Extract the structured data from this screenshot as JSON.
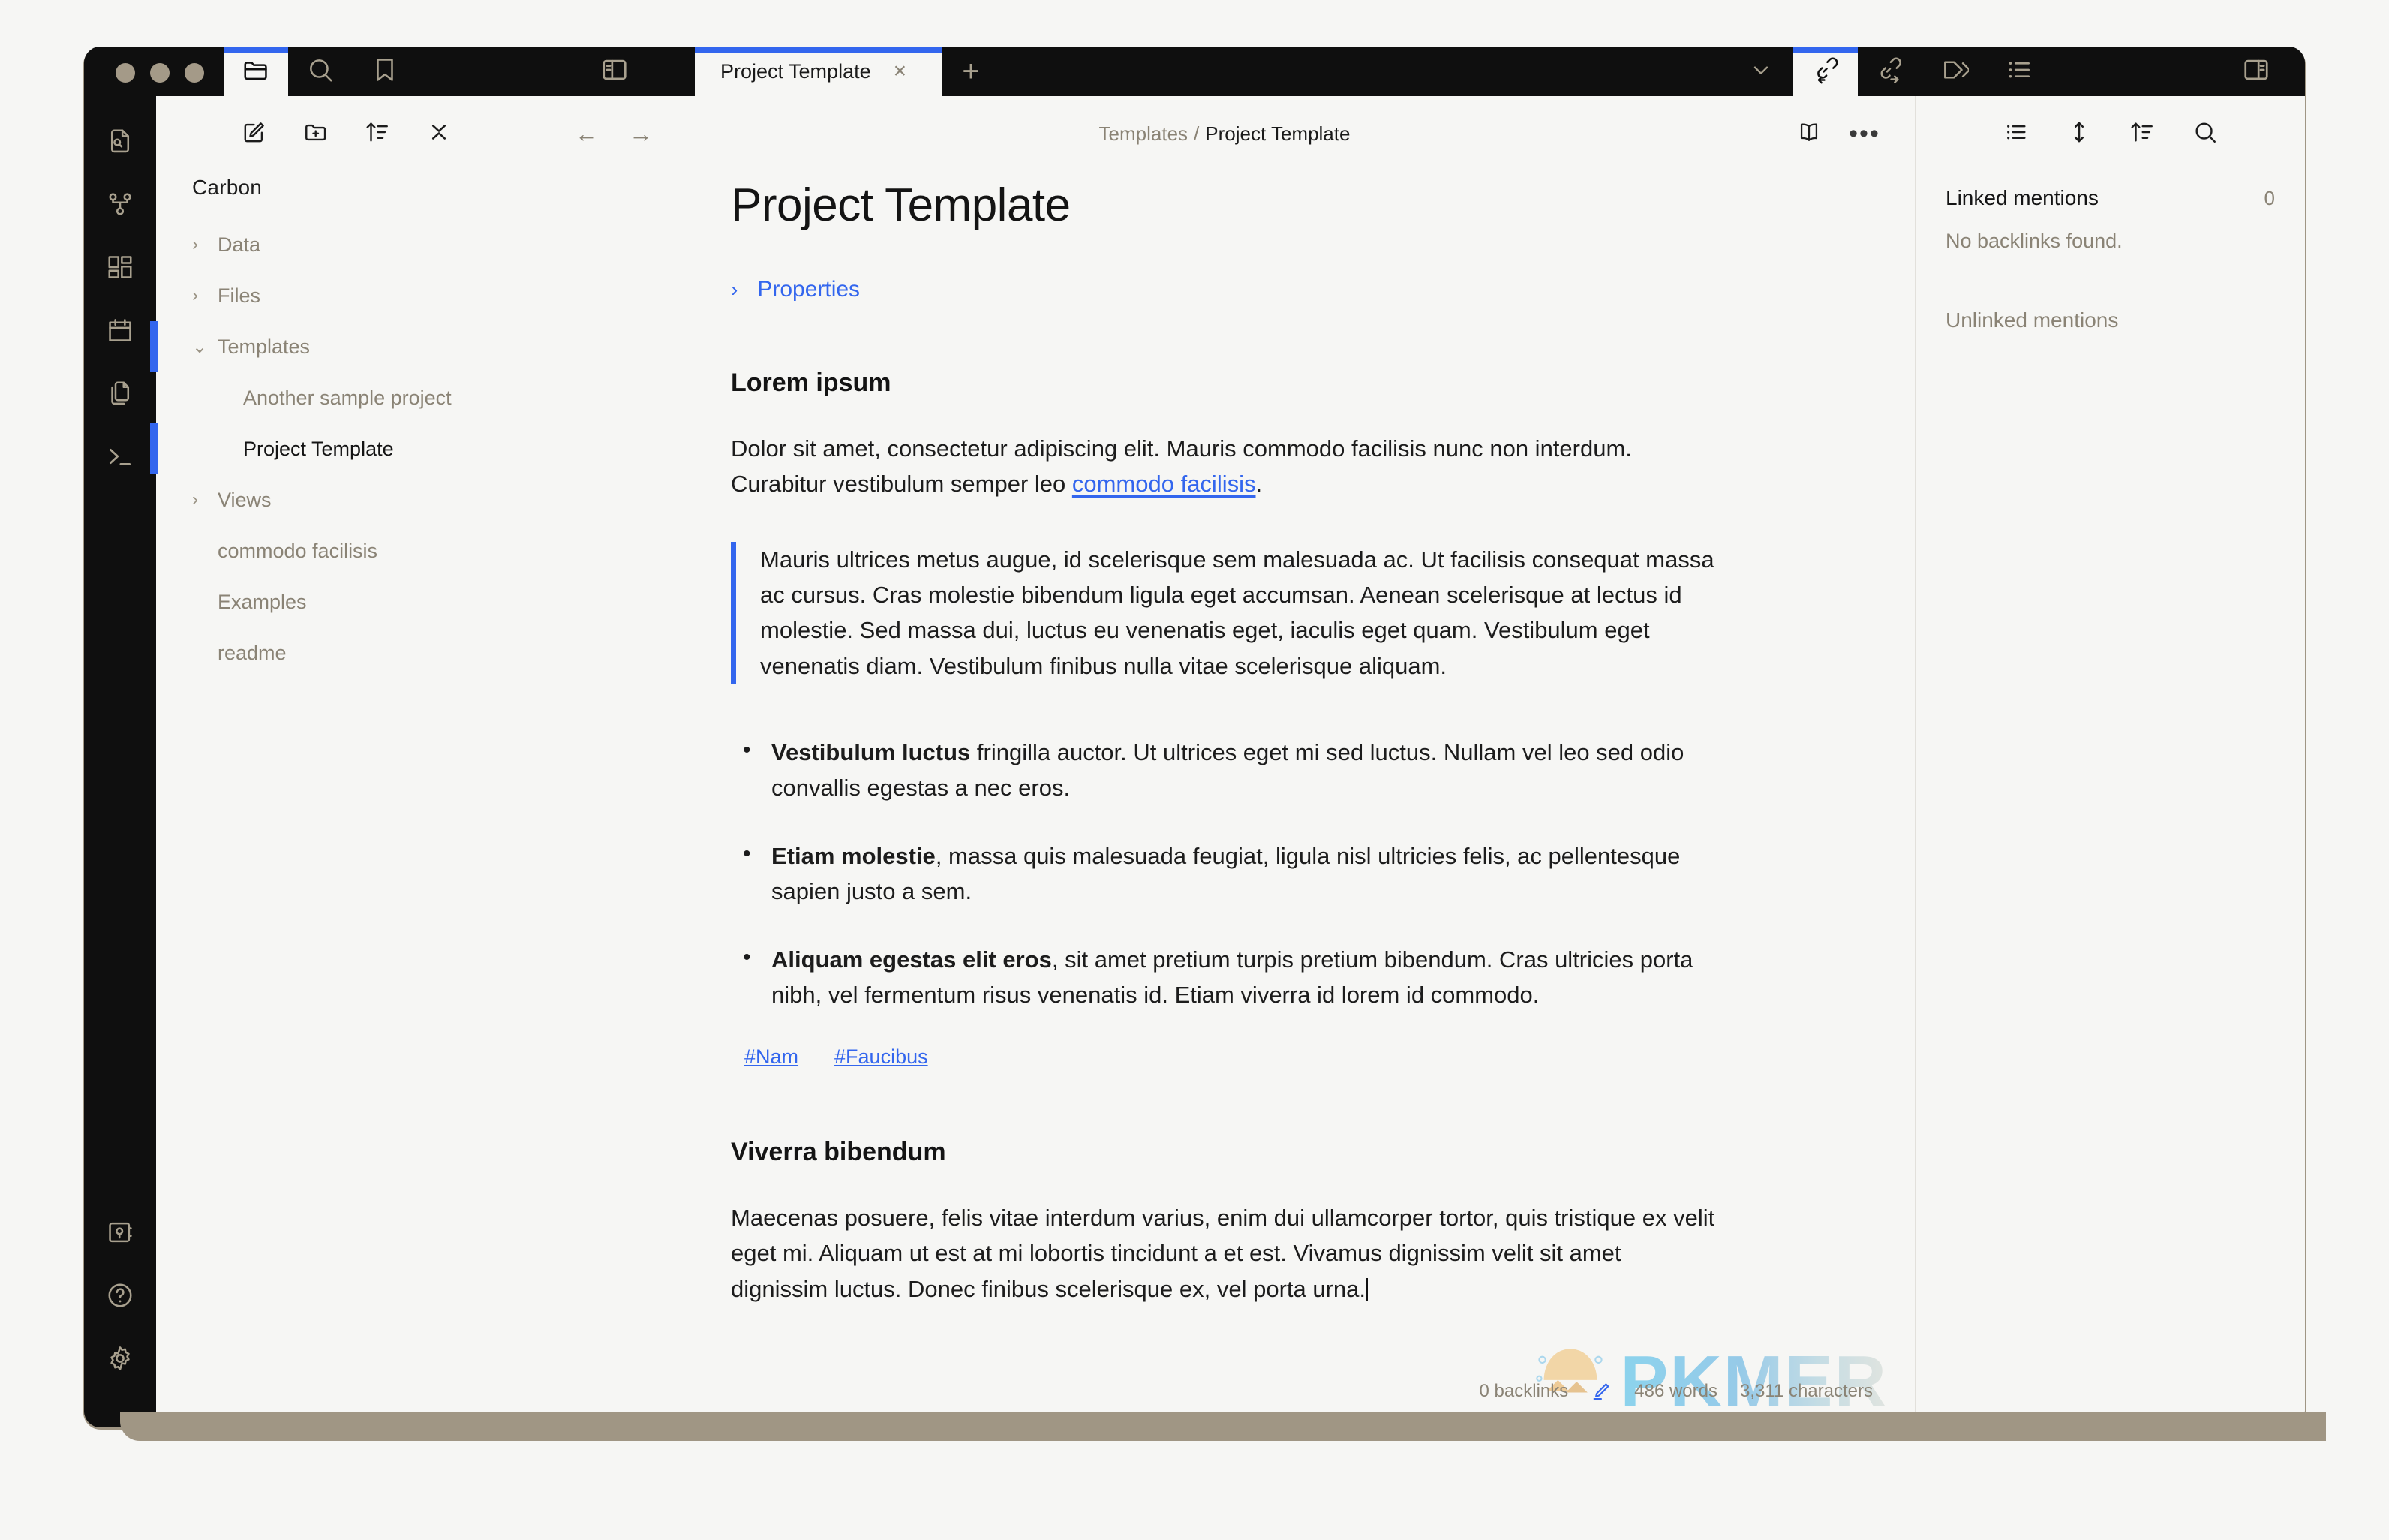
{
  "app": {
    "accent_color": "#3366ee",
    "window_bg": "#0f0f0f",
    "pane_bg": "#f6f6f4",
    "muted_text": "#8a8375",
    "frame_band": "#a09684"
  },
  "titlebar": {
    "tabs_left": [
      {
        "name": "files",
        "icon": "folder-icon",
        "active": true
      },
      {
        "name": "search",
        "icon": "search-icon",
        "active": false
      },
      {
        "name": "bookmarks",
        "icon": "bookmark-icon",
        "active": false
      }
    ],
    "sidebar_toggle_left_label": "Toggle left sidebar",
    "document_tab": {
      "title": "Project Template",
      "close_label": "×"
    },
    "new_tab_label": "+",
    "tabs_right": [
      {
        "name": "chevron-down",
        "icon": "chevron-down-icon",
        "active": false
      },
      {
        "name": "backlinks",
        "icon": "backlink-icon",
        "active": true
      },
      {
        "name": "outgoing-links",
        "icon": "outgoing-link-icon",
        "active": false
      },
      {
        "name": "tags",
        "icon": "tag-icon",
        "active": false
      },
      {
        "name": "outline",
        "icon": "outline-icon",
        "active": false
      }
    ],
    "sidebar_toggle_right_label": "Toggle right sidebar"
  },
  "ribbon": {
    "top_items": [
      {
        "name": "quick-switcher",
        "icon": "file-search-icon"
      },
      {
        "name": "graph-view",
        "icon": "graph-icon"
      },
      {
        "name": "dashboard",
        "icon": "grid-icon"
      },
      {
        "name": "calendar",
        "icon": "calendar-icon"
      },
      {
        "name": "copy-files",
        "icon": "files-icon"
      },
      {
        "name": "terminal",
        "icon": "terminal-icon"
      }
    ],
    "bottom_items": [
      {
        "name": "vault",
        "icon": "vault-icon"
      },
      {
        "name": "help",
        "icon": "help-icon"
      },
      {
        "name": "settings",
        "icon": "gear-icon"
      }
    ]
  },
  "explorer": {
    "toolbar": [
      {
        "name": "new-note",
        "icon": "new-note-icon"
      },
      {
        "name": "new-folder",
        "icon": "new-folder-icon"
      },
      {
        "name": "sort-order",
        "icon": "sort-icon"
      },
      {
        "name": "collapse-all",
        "icon": "collapse-icon"
      }
    ],
    "vault_name": "Carbon",
    "tree": [
      {
        "label": "Data",
        "type": "folder",
        "expanded": false,
        "twisty": "›",
        "active": false,
        "current": false
      },
      {
        "label": "Files",
        "type": "folder",
        "expanded": false,
        "twisty": "›",
        "active": false,
        "current": false
      },
      {
        "label": "Templates",
        "type": "folder",
        "expanded": true,
        "twisty": "⌄",
        "active": true,
        "current": false
      },
      {
        "label": "Another sample project",
        "type": "nested",
        "twisty": "",
        "active": false,
        "current": false
      },
      {
        "label": "Project Template",
        "type": "nested",
        "twisty": "",
        "active": true,
        "current": true
      },
      {
        "label": "Views",
        "type": "folder",
        "expanded": false,
        "twisty": "›",
        "active": false,
        "current": false
      },
      {
        "label": "commodo facilisis",
        "type": "file",
        "twisty": "",
        "active": false,
        "current": false
      },
      {
        "label": "Examples",
        "type": "file",
        "twisty": "",
        "active": false,
        "current": false
      },
      {
        "label": "readme",
        "type": "file",
        "twisty": "",
        "active": false,
        "current": false
      }
    ]
  },
  "note_header": {
    "back_label": "←",
    "forward_label": "→",
    "breadcrumb_parent": "Templates",
    "breadcrumb_sep": "/",
    "breadcrumb_current": "Project Template",
    "reading_view_label": "Reading view",
    "more_options_label": "•••"
  },
  "note": {
    "title": "Project Template",
    "properties_twisty": "›",
    "properties_label": "Properties",
    "h1": "Lorem ipsum",
    "p1_before": "Dolor sit amet, consectetur adipiscing elit. Mauris commodo facilisis nunc non interdum. Curabitur vestibulum semper leo ",
    "p1_link": "commodo facilisis",
    "p1_after": ".",
    "blockquote": "Mauris ultrices metus augue, id scelerisque sem malesuada ac. Ut facilisis consequat massa ac cursus. Cras molestie bibendum ligula eget accumsan. Aenean scelerisque at lectus id molestie. Sed massa dui, luctus eu venenatis eget, iaculis eget quam. Vestibulum eget venenatis diam. Vestibulum finibus nulla vitae scelerisque aliquam.",
    "bullets": [
      {
        "bold": "Vestibulum luctus",
        "rest": " fringilla auctor. Ut ultrices eget mi sed luctus. Nullam vel leo sed odio convallis egestas a nec eros."
      },
      {
        "bold": "Etiam molestie",
        "rest": ", massa quis malesuada feugiat, ligula nisl ultricies felis, ac pellentesque sapien justo a sem."
      },
      {
        "bold": "Aliquam egestas elit eros",
        "rest": ", sit amet pretium turpis pretium bibendum. Cras ultricies porta nibh, vel fermentum risus venenatis id. Etiam viverra id lorem id commodo."
      }
    ],
    "tags": [
      "#Nam",
      "#Faucibus"
    ],
    "h2": "Viverra bibendum",
    "p2": "Maecenas posuere, felis vitae interdum varius, enim dui ullamcorper tortor, quis tristique ex velit eget mi. Aliquam ut est at mi lobortis tincidunt a et est. Vivamus dignissim velit sit amet dignissim luctus. Donec finibus scelerisque ex, vel porta urna."
  },
  "right_panel": {
    "toolbar": [
      {
        "name": "list-view",
        "icon": "list-icon"
      },
      {
        "name": "expand-collapse-results",
        "icon": "vertical-arrows-icon"
      },
      {
        "name": "change-sort-order",
        "icon": "sort-icon"
      },
      {
        "name": "search-backlinks",
        "icon": "search-icon"
      }
    ],
    "linked_mentions_label": "Linked mentions",
    "linked_mentions_count": "0",
    "no_backlinks_text": "No backlinks found.",
    "unlinked_mentions_label": "Unlinked mentions"
  },
  "status_bar": {
    "backlinks": "0 backlinks",
    "edit_icon": "pencil-icon",
    "words": "486 words",
    "characters": "3,311 characters"
  },
  "watermark": {
    "text": "PKMER"
  }
}
